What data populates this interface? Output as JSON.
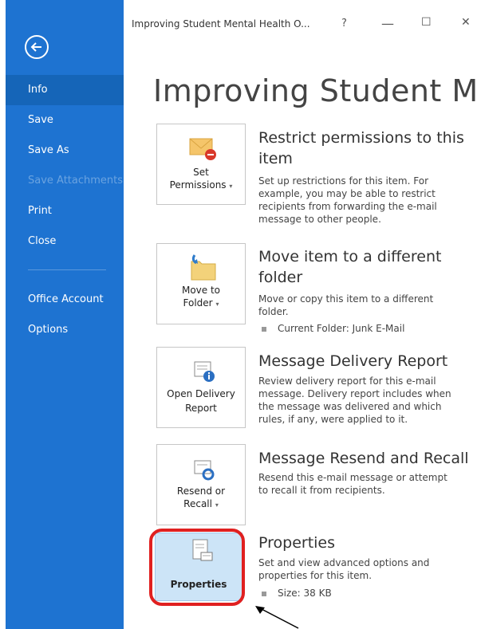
{
  "window": {
    "title": "Improving Student Mental Health O...",
    "help": "?",
    "minimize": "—",
    "maximize": "☐",
    "close": "✕"
  },
  "page_title": "Improving Student M...",
  "sidebar": {
    "items": [
      {
        "label": "Info"
      },
      {
        "label": "Save"
      },
      {
        "label": "Save As"
      },
      {
        "label": "Save Attachments"
      },
      {
        "label": "Print"
      },
      {
        "label": "Close"
      },
      {
        "label": "Office Account"
      },
      {
        "label": "Options"
      }
    ]
  },
  "sections": [
    {
      "button_line1": "Set",
      "button_line2": "Permissions",
      "title": "Restrict permissions to this item",
      "desc": "Set up restrictions for this item. For example, you may be able to restrict recipients from forwarding the e-mail message to other people."
    },
    {
      "button_line1": "Move to",
      "button_line2": "Folder",
      "title": "Move item to a different folder",
      "desc": "Move or copy this item to a different folder.",
      "bullet": "Current Folder:  Junk E-Mail"
    },
    {
      "button_line1": "Open Delivery",
      "button_line2": "Report",
      "title": "Message Delivery Report",
      "desc": "Review delivery report for this e-mail message. Delivery report includes when the message was delivered and which rules, if any, were applied to it."
    },
    {
      "button_line1": "Resend or",
      "button_line2": "Recall",
      "title": "Message Resend and Recall",
      "desc": "Resend this e-mail message or attempt to recall it from recipients."
    },
    {
      "button_line1": "Properties",
      "title": "Properties",
      "desc": "Set and view advanced options and properties for this item.",
      "bullet": "Size:  38 KB"
    }
  ],
  "caret": "▾",
  "colors": {
    "sidebar": "#1e73d1",
    "highlight": "#e02020"
  }
}
